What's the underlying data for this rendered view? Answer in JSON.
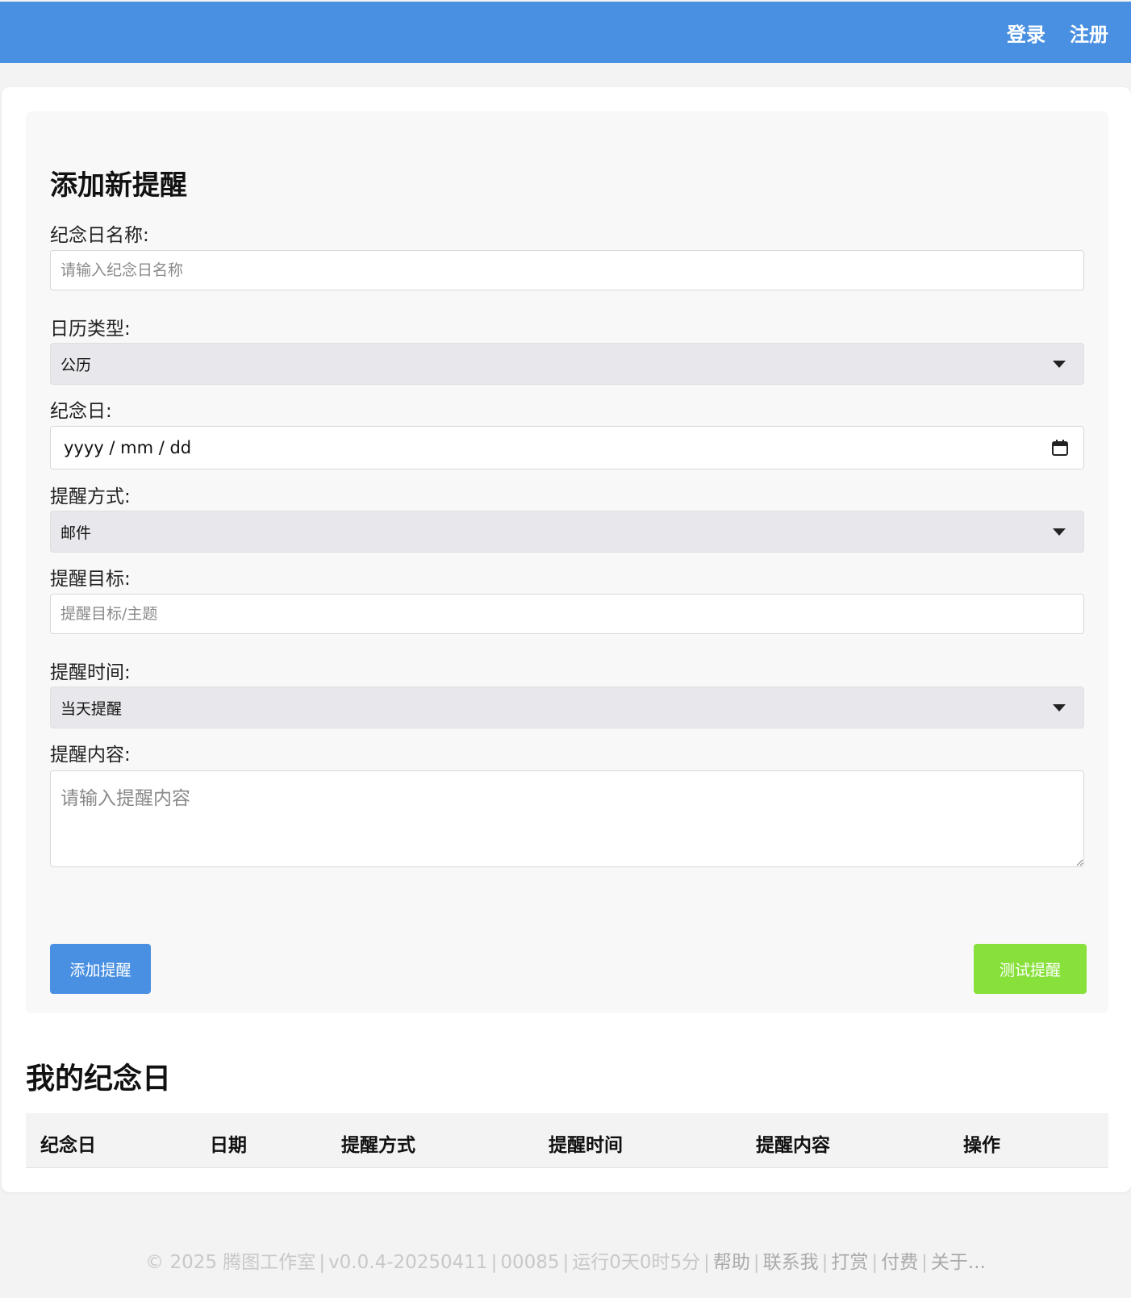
{
  "header": {
    "login_label": "登录",
    "register_label": "注册",
    "bg_color": "#4a90e2"
  },
  "form": {
    "title": "添加新提醒",
    "name": {
      "label": "纪念日名称:",
      "placeholder": "请输入纪念日名称",
      "value": ""
    },
    "calendar_type": {
      "label": "日历类型:",
      "selected": "公历"
    },
    "date": {
      "label": "纪念日:",
      "placeholder": "yyyy / mm / dd"
    },
    "method": {
      "label": "提醒方式:",
      "selected": "邮件"
    },
    "target": {
      "label": "提醒目标:",
      "placeholder": "提醒目标/主题",
      "value": ""
    },
    "time": {
      "label": "提醒时间:",
      "selected": "当天提醒"
    },
    "content": {
      "label": "提醒内容:",
      "placeholder": "请输入提醒内容",
      "value": ""
    },
    "add_button": "添加提醒",
    "test_button": "测试提醒"
  },
  "list": {
    "title": "我的纪念日",
    "columns": [
      "纪念日",
      "日期",
      "提醒方式",
      "提醒时间",
      "提醒内容",
      "操作"
    ],
    "rows": []
  },
  "footer": {
    "copyright": "© 2025 腾图工作室",
    "version": "v0.0.4-20250411",
    "count": "00085",
    "uptime": "运行0天0时5分",
    "links": [
      "帮助",
      "联系我",
      "打赏",
      "付费",
      "关于..."
    ]
  },
  "colors": {
    "primary": "#4a90e2",
    "test_button": "#87e13a",
    "select_bg": "#e8e8ec"
  }
}
